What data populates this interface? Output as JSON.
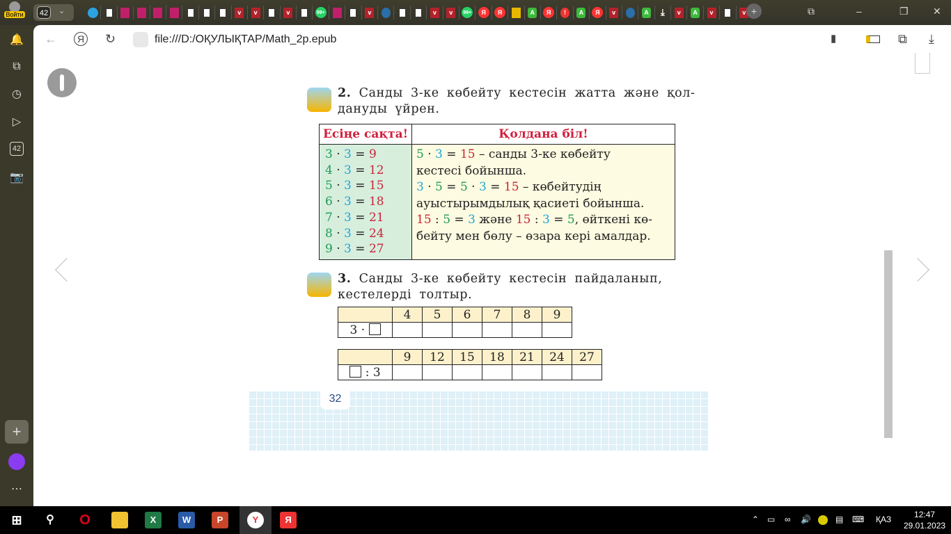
{
  "topbar": {
    "login_label": "Войти",
    "tab_count": "42",
    "tabs": [
      "tg",
      "doc",
      "book",
      "book",
      "book",
      "book",
      "doc",
      "doc",
      "doc",
      "shield",
      "shield",
      "doc",
      "shield",
      "doc",
      "wa",
      "book",
      "doc",
      "shield",
      "other",
      "doc",
      "doc",
      "shield",
      "shield",
      "wa",
      "ya",
      "ya",
      "img",
      "grn",
      "ya",
      "warn",
      "grn",
      "ya",
      "shield",
      "other",
      "grn",
      "dl",
      "shield",
      "grn",
      "shield",
      "doc",
      "shield"
    ],
    "wa_badge": "99+",
    "ya_letter": "Я",
    "grn_letter": "A",
    "warn_letter": "!"
  },
  "sidebar": {
    "count_badge": "42"
  },
  "address": {
    "url": "file:///D:/ОҚУЛЫҚТАР/Math_2p.epub"
  },
  "page": {
    "ex2": {
      "num": "2.",
      "text": "Санды 3-ке көбейту кестесін жатта және қол-данудыүйрен.",
      "line1": "Санды 3-ке көбейту кестесін жатта және қол-",
      "line2": "дануды үйрен."
    },
    "table": {
      "h_left": "Есіңе сақта!",
      "h_right": "Қолдана біл!",
      "facts": [
        [
          "3",
          "3",
          "9"
        ],
        [
          "4",
          "3",
          "12"
        ],
        [
          "5",
          "3",
          "15"
        ],
        [
          "6",
          "3",
          "18"
        ],
        [
          "7",
          "3",
          "21"
        ],
        [
          "8",
          "3",
          "24"
        ],
        [
          "9",
          "3",
          "27"
        ]
      ],
      "r1_a": "5",
      "r1_b": "3",
      "r1_c": "15",
      "r1_t": " – санды 3-ке көбейту",
      "r2": "кестесі бойынша.",
      "r3_a": "3",
      "r3_b": "5",
      "r3_c": "5",
      "r3_d": "3",
      "r3_e": "15",
      "r3_t": " – көбейтудің",
      "r4": "ауыстырымдылық қасиеті бойынша.",
      "r5_a": "15",
      "r5_b": "5",
      "r5_c": "3",
      "r5_and": " және ",
      "r5_d": "15",
      "r5_e": "3",
      "r5_f": "5",
      "r5_t": ", өйткені кө-",
      "r6": "бейту  мен бөлу – өзара кері амалдар."
    },
    "ex3": {
      "num": "3.",
      "line1": "Санды 3-ке көбейту кестесін пайдаланып,",
      "line2": "кестелерді толтыр."
    },
    "t1": {
      "row_label": "3 ·",
      "headers": [
        "4",
        "5",
        "6",
        "7",
        "8",
        "9"
      ]
    },
    "t2": {
      "row_label": ": 3",
      "headers": [
        "9",
        "12",
        "15",
        "18",
        "21",
        "24",
        "27"
      ]
    },
    "page_number": "32"
  },
  "taskbar": {
    "lang": "ҚАЗ",
    "time": "12:47",
    "date": "29.01.2023"
  }
}
